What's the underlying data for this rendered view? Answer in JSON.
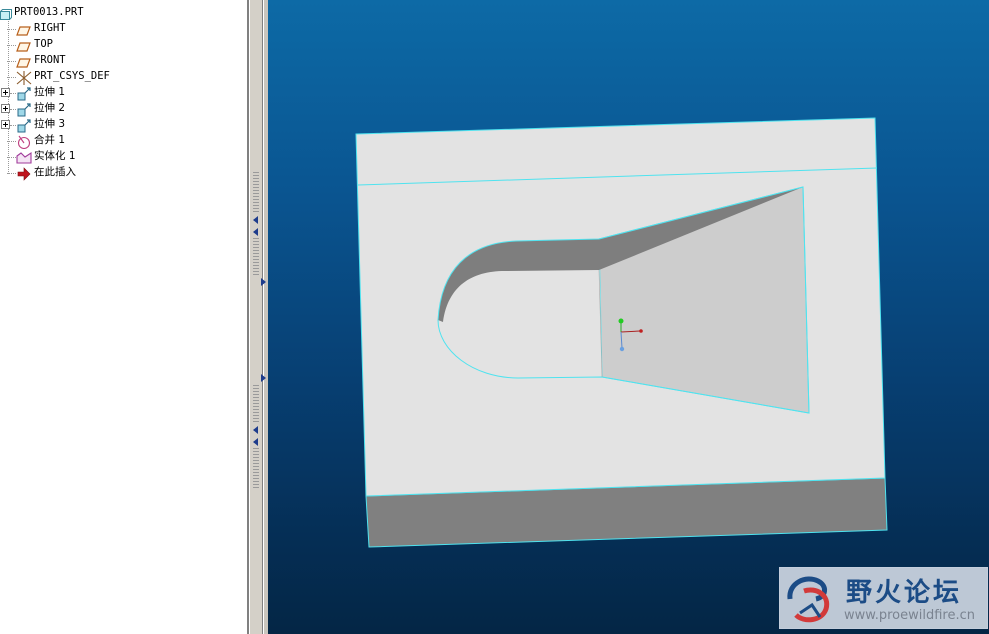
{
  "model_tree": {
    "root": {
      "label": "PRT0013.PRT",
      "icon": "part-icon"
    },
    "items": [
      {
        "label": "RIGHT",
        "icon": "datum-plane-icon",
        "expandable": false
      },
      {
        "label": "TOP",
        "icon": "datum-plane-icon",
        "expandable": false
      },
      {
        "label": "FRONT",
        "icon": "datum-plane-icon",
        "expandable": false
      },
      {
        "label": "PRT_CSYS_DEF",
        "icon": "coordinate-system-icon",
        "expandable": false
      },
      {
        "label": "拉伸 1",
        "icon": "extrude-icon",
        "expandable": true
      },
      {
        "label": "拉伸 2",
        "icon": "extrude-icon",
        "expandable": true
      },
      {
        "label": "拉伸 3",
        "icon": "extrude-icon",
        "expandable": true
      },
      {
        "label": "合并 1",
        "icon": "merge-icon",
        "expandable": false
      },
      {
        "label": "实体化 1",
        "icon": "solidify-icon",
        "expandable": false
      },
      {
        "label": "在此插入",
        "icon": "insert-here-arrow-icon",
        "expandable": false
      }
    ]
  },
  "watermark": {
    "title": "野火论坛",
    "url": "www.proewildfire.cn"
  },
  "colors": {
    "viewport_top": "#0d6aa6",
    "viewport_bottom": "#042645",
    "edge_highlight": "#4fe3ef",
    "model_face": "#e3e3e3",
    "model_side": "#808080"
  }
}
